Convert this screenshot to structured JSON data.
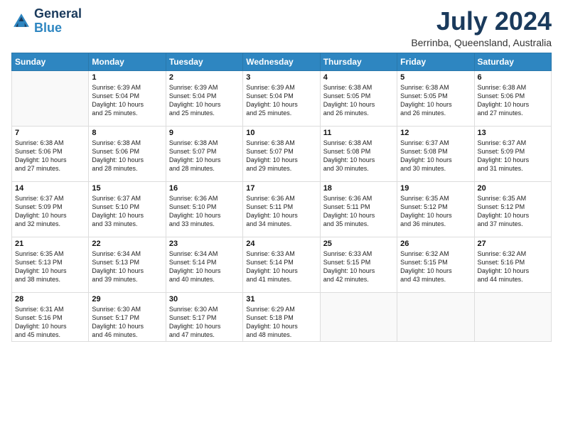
{
  "header": {
    "logo_line1": "General",
    "logo_line2": "Blue",
    "month_year": "July 2024",
    "location": "Berrinba, Queensland, Australia"
  },
  "weekdays": [
    "Sunday",
    "Monday",
    "Tuesday",
    "Wednesday",
    "Thursday",
    "Friday",
    "Saturday"
  ],
  "rows": [
    [
      {
        "day": "",
        "text": ""
      },
      {
        "day": "1",
        "text": "Sunrise: 6:39 AM\nSunset: 5:04 PM\nDaylight: 10 hours\nand 25 minutes."
      },
      {
        "day": "2",
        "text": "Sunrise: 6:39 AM\nSunset: 5:04 PM\nDaylight: 10 hours\nand 25 minutes."
      },
      {
        "day": "3",
        "text": "Sunrise: 6:39 AM\nSunset: 5:04 PM\nDaylight: 10 hours\nand 25 minutes."
      },
      {
        "day": "4",
        "text": "Sunrise: 6:38 AM\nSunset: 5:05 PM\nDaylight: 10 hours\nand 26 minutes."
      },
      {
        "day": "5",
        "text": "Sunrise: 6:38 AM\nSunset: 5:05 PM\nDaylight: 10 hours\nand 26 minutes."
      },
      {
        "day": "6",
        "text": "Sunrise: 6:38 AM\nSunset: 5:06 PM\nDaylight: 10 hours\nand 27 minutes."
      }
    ],
    [
      {
        "day": "7",
        "text": "Sunrise: 6:38 AM\nSunset: 5:06 PM\nDaylight: 10 hours\nand 27 minutes."
      },
      {
        "day": "8",
        "text": "Sunrise: 6:38 AM\nSunset: 5:06 PM\nDaylight: 10 hours\nand 28 minutes."
      },
      {
        "day": "9",
        "text": "Sunrise: 6:38 AM\nSunset: 5:07 PM\nDaylight: 10 hours\nand 28 minutes."
      },
      {
        "day": "10",
        "text": "Sunrise: 6:38 AM\nSunset: 5:07 PM\nDaylight: 10 hours\nand 29 minutes."
      },
      {
        "day": "11",
        "text": "Sunrise: 6:38 AM\nSunset: 5:08 PM\nDaylight: 10 hours\nand 30 minutes."
      },
      {
        "day": "12",
        "text": "Sunrise: 6:37 AM\nSunset: 5:08 PM\nDaylight: 10 hours\nand 30 minutes."
      },
      {
        "day": "13",
        "text": "Sunrise: 6:37 AM\nSunset: 5:09 PM\nDaylight: 10 hours\nand 31 minutes."
      }
    ],
    [
      {
        "day": "14",
        "text": "Sunrise: 6:37 AM\nSunset: 5:09 PM\nDaylight: 10 hours\nand 32 minutes."
      },
      {
        "day": "15",
        "text": "Sunrise: 6:37 AM\nSunset: 5:10 PM\nDaylight: 10 hours\nand 33 minutes."
      },
      {
        "day": "16",
        "text": "Sunrise: 6:36 AM\nSunset: 5:10 PM\nDaylight: 10 hours\nand 33 minutes."
      },
      {
        "day": "17",
        "text": "Sunrise: 6:36 AM\nSunset: 5:11 PM\nDaylight: 10 hours\nand 34 minutes."
      },
      {
        "day": "18",
        "text": "Sunrise: 6:36 AM\nSunset: 5:11 PM\nDaylight: 10 hours\nand 35 minutes."
      },
      {
        "day": "19",
        "text": "Sunrise: 6:35 AM\nSunset: 5:12 PM\nDaylight: 10 hours\nand 36 minutes."
      },
      {
        "day": "20",
        "text": "Sunrise: 6:35 AM\nSunset: 5:12 PM\nDaylight: 10 hours\nand 37 minutes."
      }
    ],
    [
      {
        "day": "21",
        "text": "Sunrise: 6:35 AM\nSunset: 5:13 PM\nDaylight: 10 hours\nand 38 minutes."
      },
      {
        "day": "22",
        "text": "Sunrise: 6:34 AM\nSunset: 5:13 PM\nDaylight: 10 hours\nand 39 minutes."
      },
      {
        "day": "23",
        "text": "Sunrise: 6:34 AM\nSunset: 5:14 PM\nDaylight: 10 hours\nand 40 minutes."
      },
      {
        "day": "24",
        "text": "Sunrise: 6:33 AM\nSunset: 5:14 PM\nDaylight: 10 hours\nand 41 minutes."
      },
      {
        "day": "25",
        "text": "Sunrise: 6:33 AM\nSunset: 5:15 PM\nDaylight: 10 hours\nand 42 minutes."
      },
      {
        "day": "26",
        "text": "Sunrise: 6:32 AM\nSunset: 5:15 PM\nDaylight: 10 hours\nand 43 minutes."
      },
      {
        "day": "27",
        "text": "Sunrise: 6:32 AM\nSunset: 5:16 PM\nDaylight: 10 hours\nand 44 minutes."
      }
    ],
    [
      {
        "day": "28",
        "text": "Sunrise: 6:31 AM\nSunset: 5:16 PM\nDaylight: 10 hours\nand 45 minutes."
      },
      {
        "day": "29",
        "text": "Sunrise: 6:30 AM\nSunset: 5:17 PM\nDaylight: 10 hours\nand 46 minutes."
      },
      {
        "day": "30",
        "text": "Sunrise: 6:30 AM\nSunset: 5:17 PM\nDaylight: 10 hours\nand 47 minutes."
      },
      {
        "day": "31",
        "text": "Sunrise: 6:29 AM\nSunset: 5:18 PM\nDaylight: 10 hours\nand 48 minutes."
      },
      {
        "day": "",
        "text": ""
      },
      {
        "day": "",
        "text": ""
      },
      {
        "day": "",
        "text": ""
      }
    ]
  ]
}
